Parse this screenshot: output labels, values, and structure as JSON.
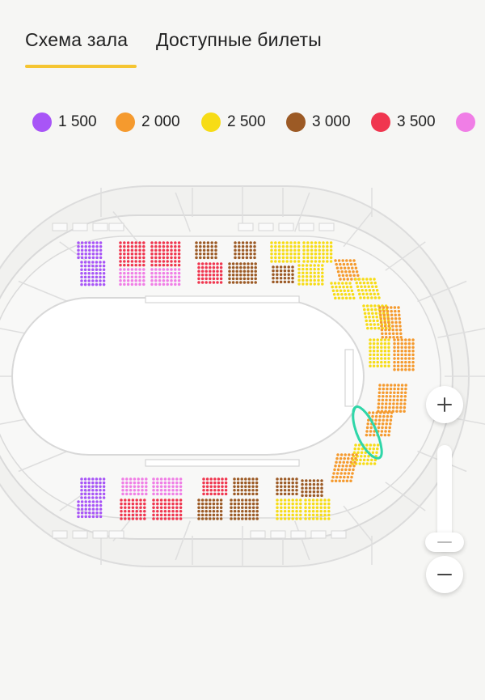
{
  "tabs": [
    {
      "label": "Схема зала",
      "active": true
    },
    {
      "label": "Доступные билеты",
      "active": false
    }
  ],
  "accent_color": "#f5c531",
  "legend": [
    {
      "label": "1 500",
      "color": "#a855f7"
    },
    {
      "label": "2 000",
      "color": "#f59a2e"
    },
    {
      "label": "2 500",
      "color": "#f7dc16"
    },
    {
      "label": "3 000",
      "color": "#9c5a25"
    },
    {
      "label": "3 500",
      "color": "#f0364f"
    },
    {
      "label": "",
      "color": "#f07ee6"
    }
  ],
  "zoom": {
    "in_icon": "plus-icon",
    "out_icon": "minus-icon",
    "level": 0.1
  }
}
